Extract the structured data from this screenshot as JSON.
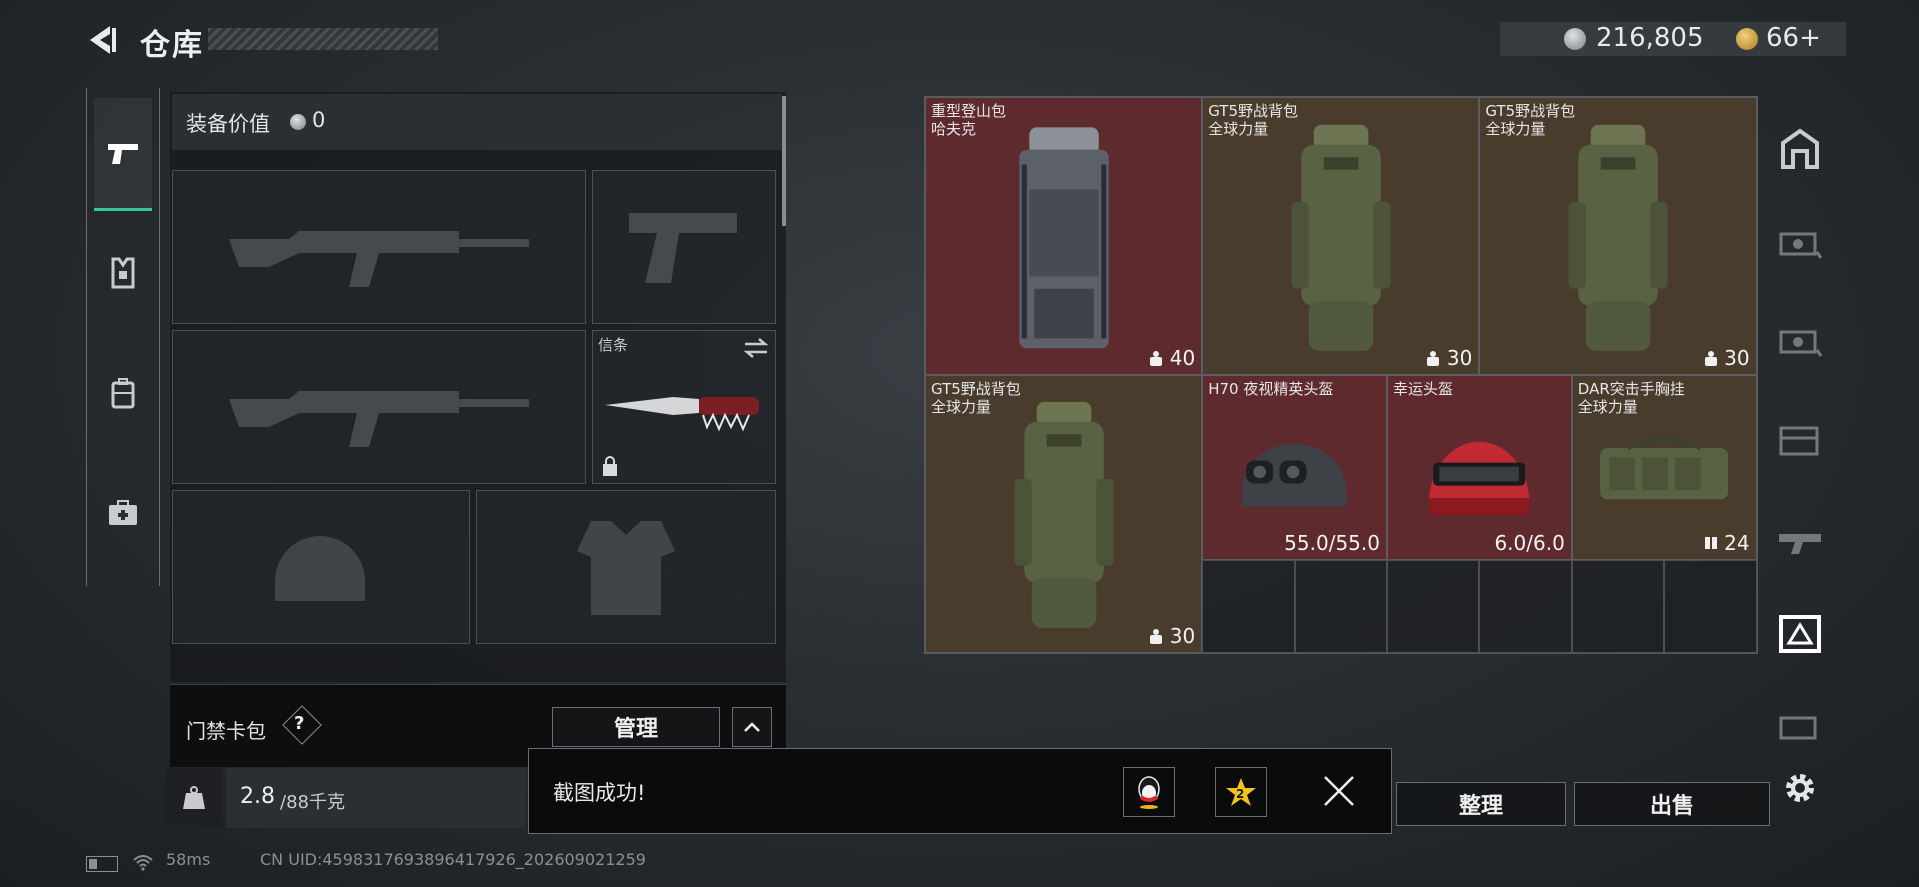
{
  "header": {
    "title": "仓库",
    "silver_amount": "216,805",
    "gold_amount": "66+"
  },
  "equipment": {
    "value_label": "装备价值",
    "value": "0",
    "melee_slot_label": "信条"
  },
  "card_pack": {
    "label": "门禁卡包",
    "help": "?",
    "manage_button": "管理"
  },
  "weight": {
    "current": "2.8",
    "max": "/88千克",
    "icon_text": "KG"
  },
  "inventory": [
    {
      "name": "重型登山包",
      "sub": "哈夫克",
      "stat": "40",
      "rarity_color": "#5e2a2e"
    },
    {
      "name": "GT5野战背包",
      "sub": "全球力量",
      "stat": "30",
      "rarity_color": "#4a3c2c"
    },
    {
      "name": "GT5野战背包",
      "sub": "全球力量",
      "stat": "30",
      "rarity_color": "#4a3c2c"
    },
    {
      "name": "GT5野战背包",
      "sub": "全球力量",
      "stat": "30",
      "rarity_color": "#4a3c2c"
    },
    {
      "name": "H70 夜视精英头盔",
      "sub": "",
      "stat": "55.0/55.0",
      "rarity_color": "#5e2a2e"
    },
    {
      "name": "幸运头盔",
      "sub": "",
      "stat": "6.0/6.0",
      "rarity_color": "#5e2a2e"
    },
    {
      "name": "DAR突击手胸挂",
      "sub": "全球力量",
      "stat": "24",
      "rarity_color": "#4a3c2c"
    }
  ],
  "actions": {
    "organize": "整理",
    "sell": "出售"
  },
  "toast": {
    "message": "截图成功!"
  },
  "status": {
    "ping": "58ms",
    "uid": "CN UID:4598317693896417926_202609021259"
  },
  "colors": {
    "accent": "#35c896",
    "red_rarity": "#5e2a2e",
    "gold_rarity": "#4a3c2c"
  }
}
